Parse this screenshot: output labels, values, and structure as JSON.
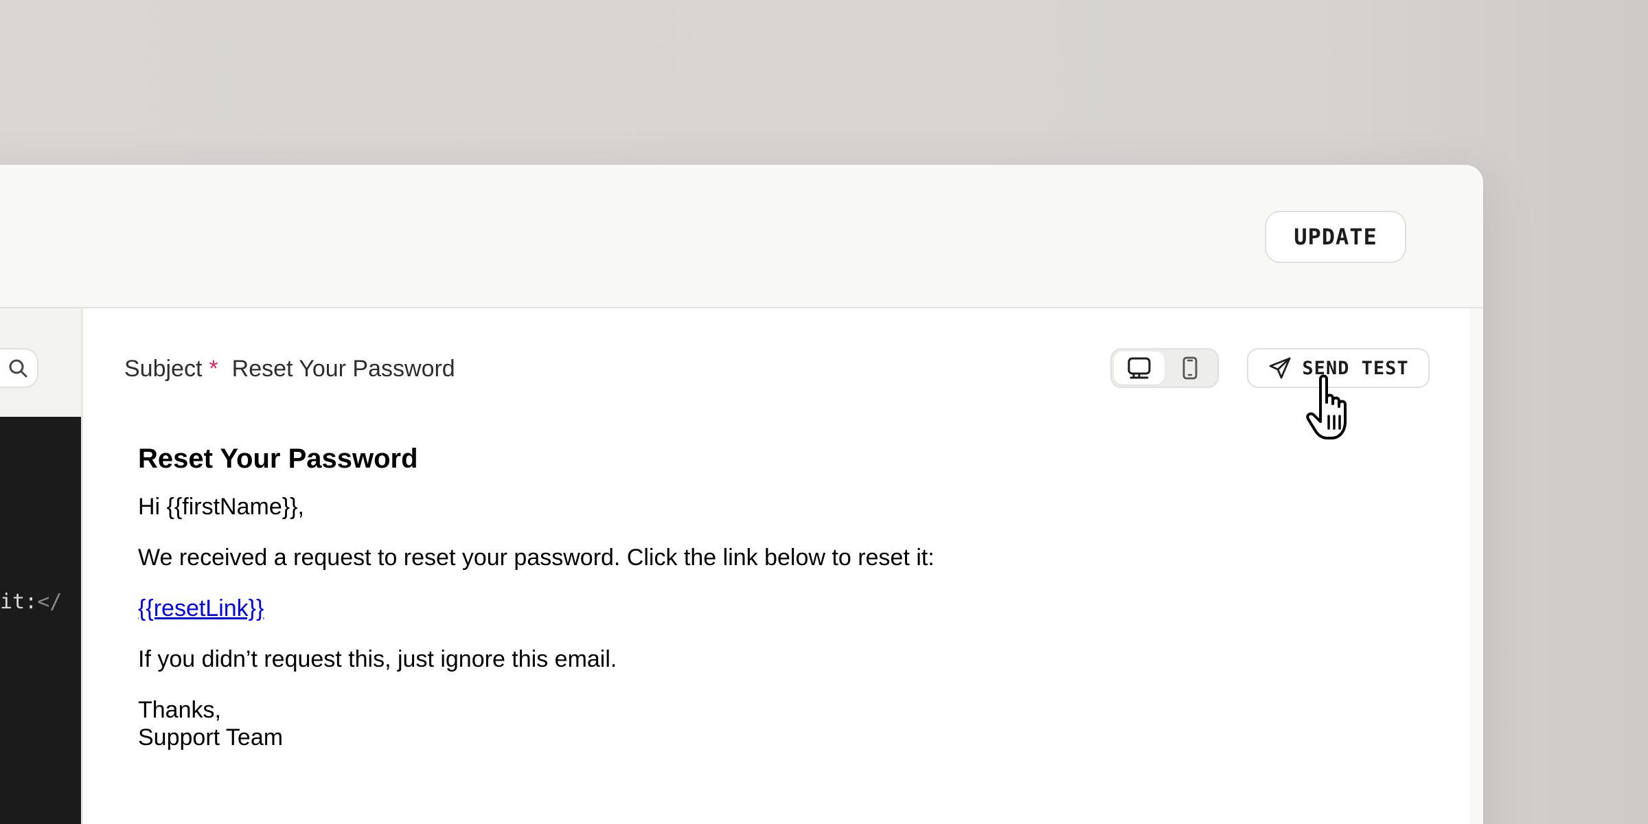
{
  "toolbar": {
    "update_label": "UPDATE"
  },
  "left_pane": {
    "search_icon": "search-icon",
    "code_snippet": {
      "text": "it:",
      "tag": "</"
    }
  },
  "preview": {
    "subject_label": "Subject",
    "required_marker": "*",
    "subject_value": "Reset Your Password",
    "device_options": [
      {
        "name": "desktop",
        "icon": "monitor-icon",
        "active": true
      },
      {
        "name": "mobile",
        "icon": "phone-icon",
        "active": false
      }
    ],
    "send_test_label": "SEND TEST",
    "send_test_icon": "paper-plane-icon"
  },
  "email": {
    "heading": "Reset Your Password",
    "greeting": "Hi {{firstName}},",
    "paragraph1": "We received a request to reset your password. Click the link below to reset it:",
    "link_text": "{{resetLink}}",
    "paragraph2": "If you didn’t request this, just ignore this email.",
    "signoff": "Thanks,",
    "signature": "Support Team"
  },
  "colors": {
    "required": "#e0245e",
    "link": "#0000ee",
    "code_bg": "#1b1b1b"
  }
}
